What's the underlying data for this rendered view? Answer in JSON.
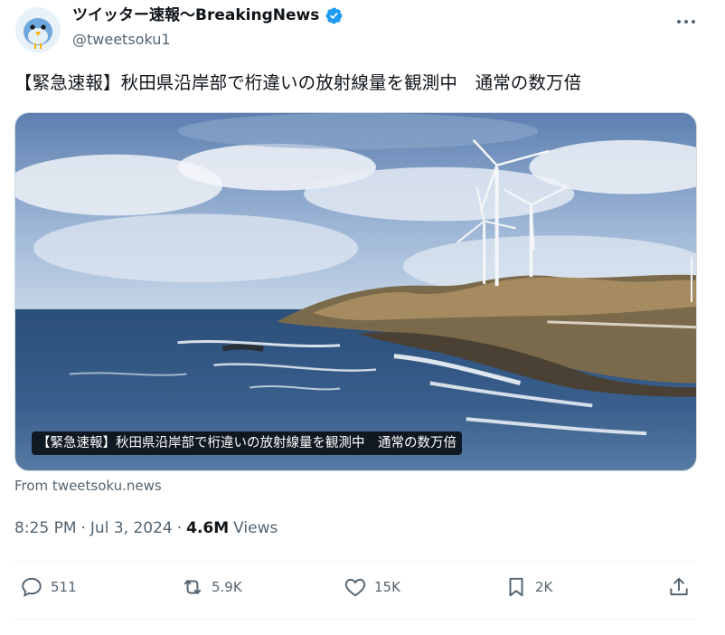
{
  "author": {
    "name": "ツイッター速報〜BreakingNews",
    "handle": "@tweetsoku1",
    "verified": true
  },
  "tweet": {
    "text": "【緊急速報】秋田県沿岸部で桁違いの放射線量を観測中　通常の数万倍"
  },
  "media": {
    "caption": "【緊急速報】秋田県沿岸部で桁違いの放射線量を観測中　通常の数万倍"
  },
  "source": "From tweetsoku.news",
  "meta": {
    "time": "8:25 PM",
    "date": "Jul 3, 2024",
    "views_count": "4.6M",
    "views_label": "Views",
    "separator": "·"
  },
  "actions": {
    "reply": "511",
    "retweet": "5.9K",
    "like": "15K",
    "bookmark": "2K"
  },
  "icons": {
    "verified": "verified-badge-icon",
    "more": "more-dots-icon",
    "reply": "speech-bubble-icon",
    "retweet": "retweet-arrows-icon",
    "like": "heart-icon",
    "bookmark": "bookmark-icon",
    "share": "share-upload-icon"
  },
  "colors": {
    "accent": "#1d9bf0",
    "secondary_text": "#536471",
    "primary_text": "#0f1419"
  }
}
